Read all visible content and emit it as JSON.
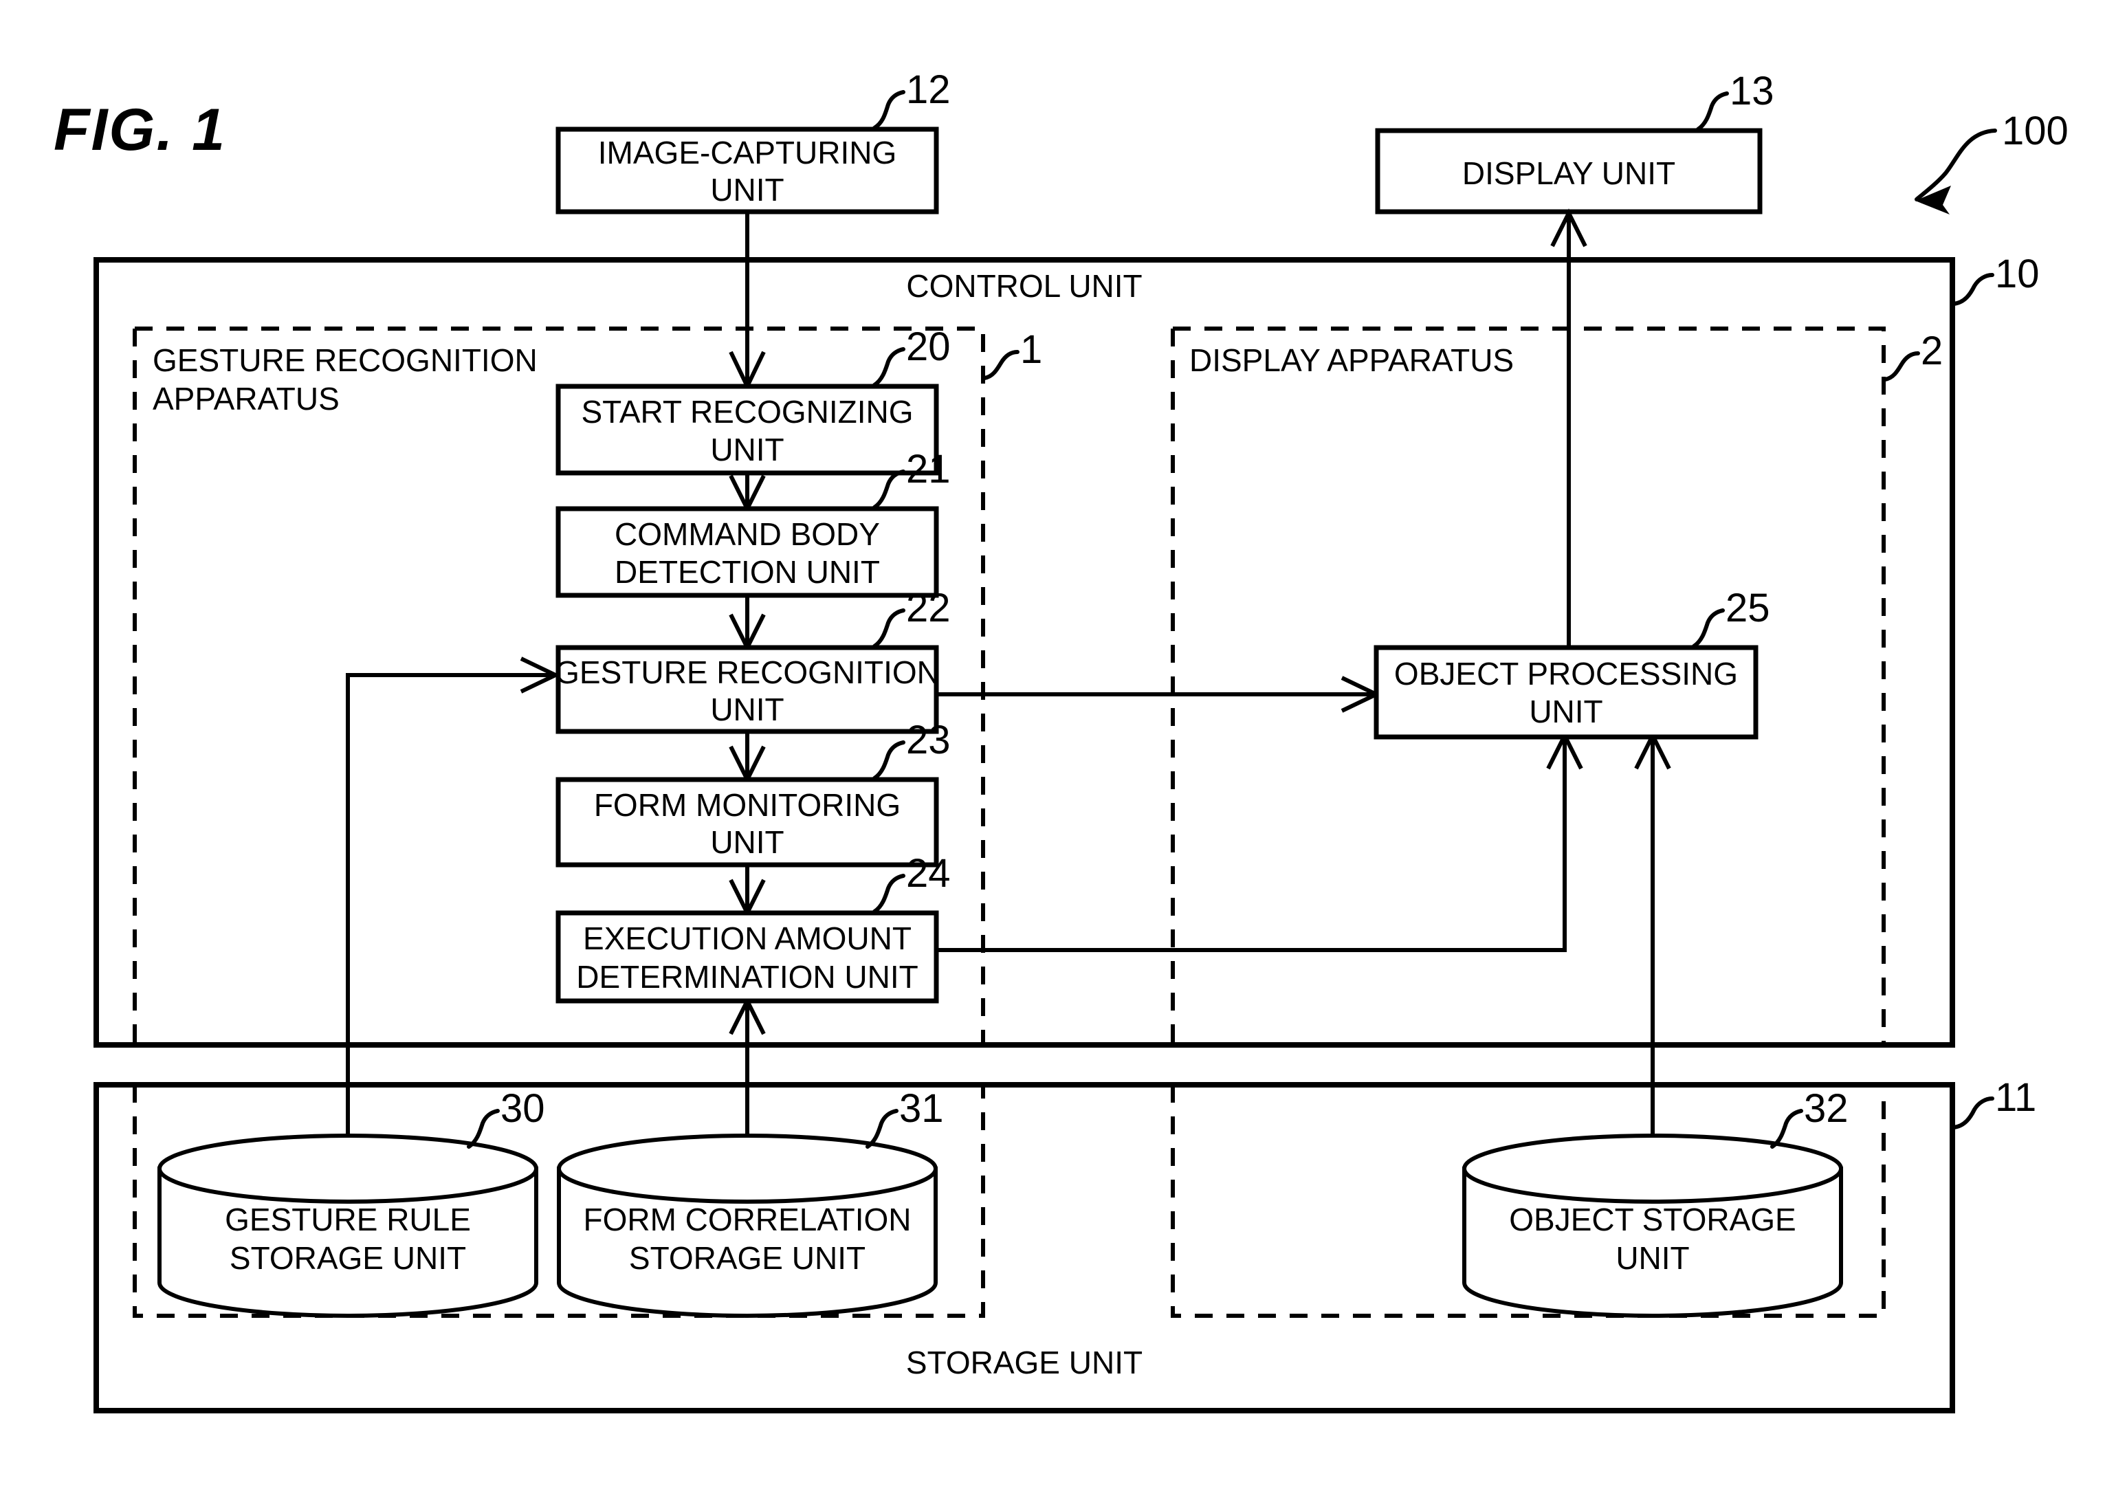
{
  "figure": {
    "title": "FIG. 1",
    "system_ref": "100"
  },
  "external_boxes": [
    {
      "id": "image-capturing-unit",
      "lines": [
        "IMAGE-CAPTURING",
        "UNIT"
      ],
      "ref": "12"
    },
    {
      "id": "display-unit",
      "lines": [
        "DISPLAY UNIT"
      ],
      "ref": "13"
    }
  ],
  "control_unit": {
    "label": "CONTROL UNIT",
    "ref": "10"
  },
  "storage_unit": {
    "label": "STORAGE UNIT",
    "ref": "11"
  },
  "zones": [
    {
      "id": "gesture-recognition-apparatus",
      "lines": [
        "GESTURE RECOGNITION",
        "APPARATUS"
      ],
      "ref": "1"
    },
    {
      "id": "display-apparatus",
      "lines": [
        "DISPLAY APPARATUS"
      ],
      "ref": "2"
    }
  ],
  "process_boxes": [
    {
      "id": "start-recognizing-unit",
      "lines": [
        "START RECOGNIZING",
        "UNIT"
      ],
      "ref": "20"
    },
    {
      "id": "command-body-detection-unit",
      "lines": [
        "COMMAND BODY",
        "DETECTION UNIT"
      ],
      "ref": "21"
    },
    {
      "id": "gesture-recognition-unit",
      "lines": [
        "GESTURE RECOGNITION",
        "UNIT"
      ],
      "ref": "22"
    },
    {
      "id": "form-monitoring-unit",
      "lines": [
        "FORM MONITORING",
        "UNIT"
      ],
      "ref": "23"
    },
    {
      "id": "execution-amount-determination-unit",
      "lines": [
        "EXECUTION AMOUNT",
        "DETERMINATION UNIT"
      ],
      "ref": "24"
    },
    {
      "id": "object-processing-unit",
      "lines": [
        "OBJECT PROCESSING",
        "UNIT"
      ],
      "ref": "25"
    }
  ],
  "storage_cylinders": [
    {
      "id": "gesture-rule-storage-unit",
      "lines": [
        "GESTURE RULE",
        "STORAGE UNIT"
      ],
      "ref": "30"
    },
    {
      "id": "form-correlation-storage-unit",
      "lines": [
        "FORM CORRELATION",
        "STORAGE UNIT"
      ],
      "ref": "31"
    },
    {
      "id": "object-storage-unit",
      "lines": [
        "OBJECT STORAGE",
        "UNIT"
      ],
      "ref": "32"
    }
  ],
  "colors": {
    "line": "#000000",
    "background": "#ffffff"
  }
}
